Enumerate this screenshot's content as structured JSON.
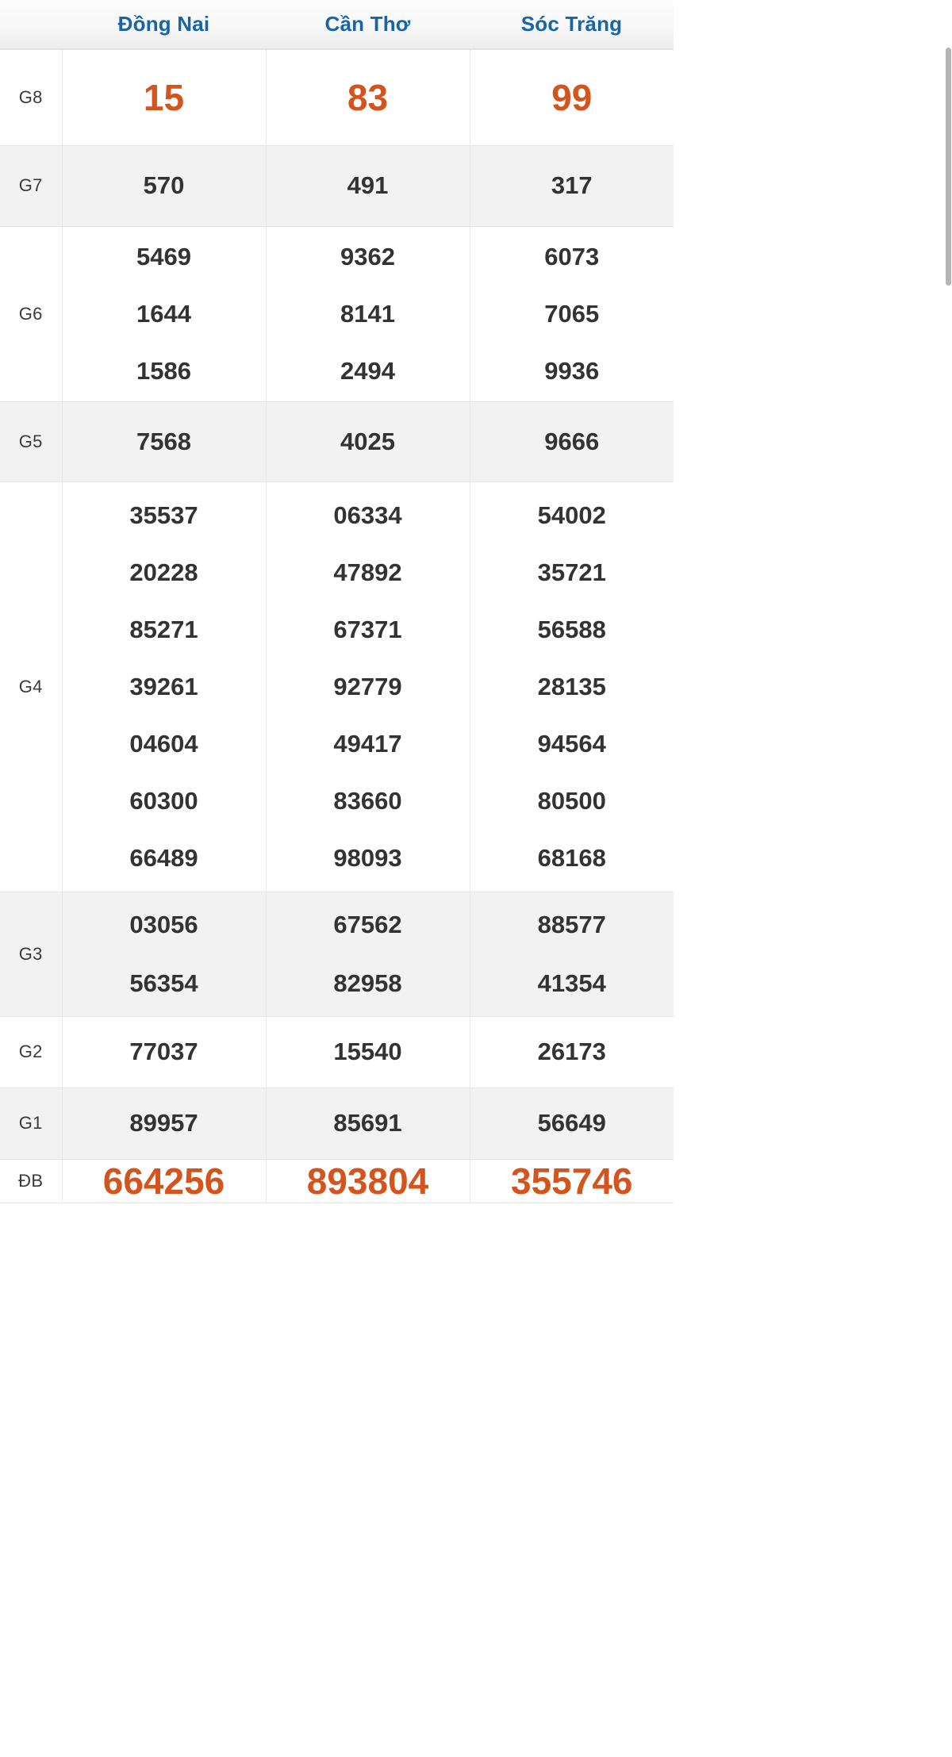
{
  "table": {
    "label_column_header": "",
    "columns": [
      "Đồng Nai",
      "Cần Thơ",
      "Sóc Trăng"
    ],
    "colors": {
      "header_text": "#1565a8",
      "highlight_value": "#d4541e",
      "normal_value": "#333333",
      "row_alt_background": "#f2f2f2"
    },
    "rows": [
      {
        "label": "G8",
        "highlight": true,
        "cells": [
          [
            "15"
          ],
          [
            "83"
          ],
          [
            "99"
          ]
        ]
      },
      {
        "label": "G7",
        "highlight": false,
        "cells": [
          [
            "570"
          ],
          [
            "491"
          ],
          [
            "317"
          ]
        ]
      },
      {
        "label": "G6",
        "highlight": false,
        "cells": [
          [
            "5469",
            "1644",
            "1586"
          ],
          [
            "9362",
            "8141",
            "2494"
          ],
          [
            "6073",
            "7065",
            "9936"
          ]
        ]
      },
      {
        "label": "G5",
        "highlight": false,
        "cells": [
          [
            "7568"
          ],
          [
            "4025"
          ],
          [
            "9666"
          ]
        ]
      },
      {
        "label": "G4",
        "highlight": false,
        "cells": [
          [
            "35537",
            "20228",
            "85271",
            "39261",
            "04604",
            "60300",
            "66489"
          ],
          [
            "06334",
            "47892",
            "67371",
            "92779",
            "49417",
            "83660",
            "98093"
          ],
          [
            "54002",
            "35721",
            "56588",
            "28135",
            "94564",
            "80500",
            "68168"
          ]
        ]
      },
      {
        "label": "G3",
        "highlight": false,
        "cells": [
          [
            "03056",
            "56354"
          ],
          [
            "67562",
            "82958"
          ],
          [
            "88577",
            "41354"
          ]
        ]
      },
      {
        "label": "G2",
        "highlight": false,
        "cells": [
          [
            "77037"
          ],
          [
            "15540"
          ],
          [
            "26173"
          ]
        ]
      },
      {
        "label": "G1",
        "highlight": false,
        "cells": [
          [
            "89957"
          ],
          [
            "85691"
          ],
          [
            "56649"
          ]
        ]
      },
      {
        "label": "ĐB",
        "highlight": true,
        "cells": [
          [
            "664256"
          ],
          [
            "893804"
          ],
          [
            "355746"
          ]
        ]
      }
    ]
  }
}
